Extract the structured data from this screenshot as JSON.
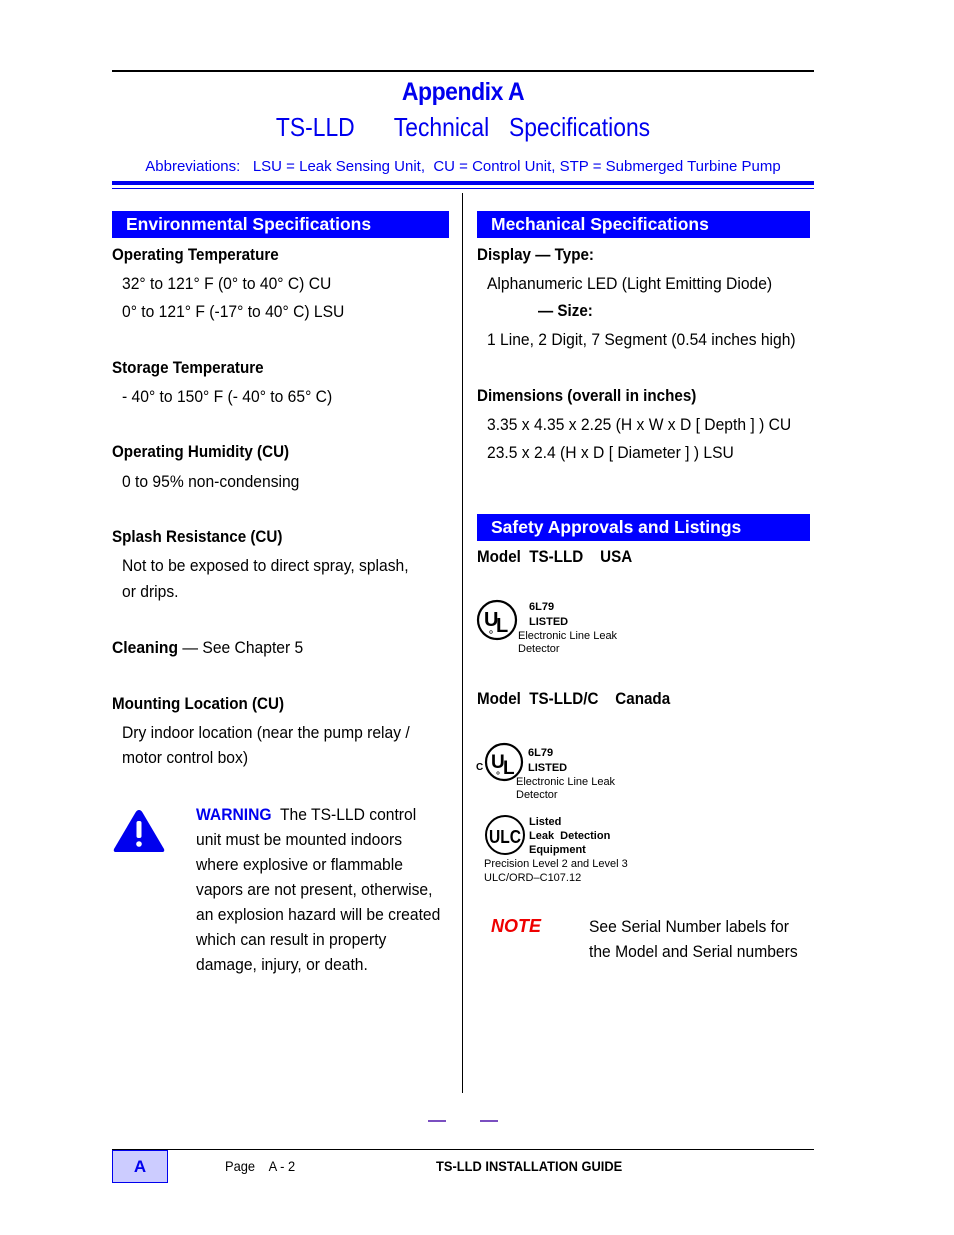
{
  "header": {
    "title": "Appendix A",
    "subtitle": "TS-LLD    Technical  Specifications",
    "abbreviations": "Abbreviations:   LSU = Leak Sensing Unit,  CU = Control Unit, STP = Submerged Turbine Pump"
  },
  "colors": {
    "accent_blue": "#0000ff",
    "title_blue": "#0000ee",
    "note_red": "#ee0000",
    "footer_box_fill": "#ccccff"
  },
  "environmental": {
    "band_title": "Environmental Specifications",
    "operating_temp": {
      "heading": "Operating  Temperature",
      "lines": [
        "32° to 121° F (0° to 40° C) CU",
        "0° to 121° F (-17° to 40° C) LSU"
      ]
    },
    "storage_temp": {
      "heading": "Storage  Temperature",
      "lines": [
        "- 40° to 150° F (- 40° to 65° C)"
      ]
    },
    "humidity": {
      "heading": "Operating Humidity (CU)",
      "lines": [
        "0 to 95% non-condensing"
      ]
    },
    "splash": {
      "heading": "Splash Resistance (CU)",
      "lines": [
        "Not to be exposed to direct spray, splash,",
        "or drips."
      ]
    },
    "cleaning": {
      "heading": "Cleaning",
      "text": " — See Chapter 5"
    },
    "mounting": {
      "heading": "Mounting Location (CU)",
      "lines": [
        "Dry indoor location (near the pump relay /",
        "motor control box)"
      ]
    },
    "warning": {
      "icon": "warning-triangle-icon",
      "label": "WARNING",
      "lines": [
        "  The TS-LLD control",
        "unit must be mounted indoors",
        "where explosive or flammable",
        "vapors are not present, otherwise,",
        "an explosion hazard will be created",
        "which can result in property",
        "damage, injury, or death."
      ]
    }
  },
  "mechanical": {
    "band_title": "Mechanical Specifications",
    "display_type_heading": "Display — Type:",
    "display_type_value": "Alphanumeric LED (Light Emitting Diode)",
    "display_size_heading": "— Size:",
    "display_size_value": "1 Line, 2 Digit, 7 Segment (0.54 inches high)",
    "dimensions_heading": "Dimensions (overall in inches)",
    "dimensions_lines": [
      "3.35 x 4.35 x 2.25 (H x W x D [ Depth ] )  CU",
      "23.5 x 2.4 (H x D [ Diameter ] )  LSU"
    ]
  },
  "safety": {
    "band_title": "Safety Approvals and Listings",
    "usa": {
      "model": "Model  TS-LLD    USA",
      "logo": "ul-listed-logo",
      "code": "6L79",
      "listed": "LISTED",
      "desc1": "Electronic Line Leak",
      "desc2": "Detector"
    },
    "canada": {
      "model": "Model  TS-LLD/C    Canada",
      "cul": {
        "logo": "cul-listed-logo",
        "prefix": "C",
        "code": "6L79",
        "listed": "LISTED",
        "desc1": "Electronic Line Leak",
        "desc2": "Detector"
      },
      "ulc": {
        "logo": "ulc-logo",
        "line1": "Listed",
        "line2": "Leak  Detection",
        "line3": "Equipment",
        "desc1": "Precision Level 2 and Level 3",
        "desc2": "ULC/ORD–C107.12"
      }
    },
    "note": {
      "label": "NOTE",
      "lines": [
        "See Serial Number labels for",
        "the Model and Serial numbers"
      ]
    }
  },
  "footer": {
    "section_letter": "A",
    "page": "Page    A - 2",
    "guide_title": "TS-LLD INSTALLATION GUIDE"
  }
}
